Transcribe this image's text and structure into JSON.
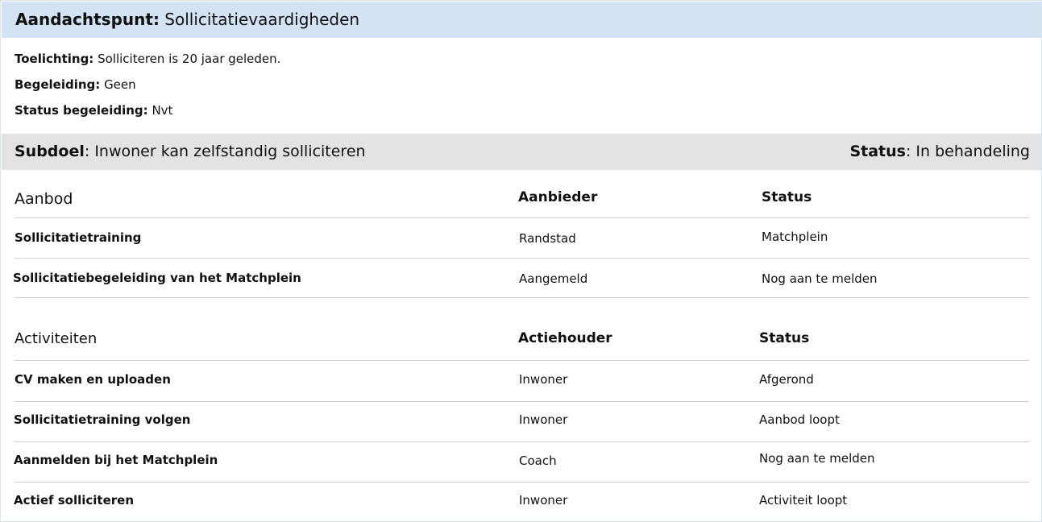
{
  "header": {
    "label": "Aandachtspunt:",
    "value": "Sollicitatievaardigheden"
  },
  "info": {
    "toelichting_label": "Toelichting:",
    "toelichting_value": "Solliciteren is 20 jaar geleden.",
    "begeleiding_label": "Begeleiding:",
    "begeleiding_value": "Geen",
    "status_begeleiding_label": "Status begeleiding:",
    "status_begeleiding_value": "Nvt"
  },
  "subdoel": {
    "label": "Subdoel",
    "value": ": Inwoner kan zelfstandig solliciteren",
    "status_label": "Status",
    "status_value": ": In behandeling"
  },
  "aanbod": {
    "headers": [
      "Aanbod",
      "Aanbieder",
      "Status"
    ],
    "rows": [
      [
        "Sollicitatietraining",
        "Randstad",
        "Matchplein"
      ],
      [
        "Sollicitatiebegeleiding van het Matchplein",
        "Aangemeld",
        "Nog aan te melden"
      ]
    ]
  },
  "activiteiten": {
    "headers": [
      "Activiteiten",
      "Actiehouder",
      "Status"
    ],
    "rows": [
      [
        "CV maken en uploaden",
        "Inwoner",
        "Afgerond"
      ],
      [
        "Sollicitatietraining volgen",
        "Inwoner",
        "Aanbod loopt"
      ],
      [
        "Aanmelden bij het Matchplein",
        "Coach",
        "Nog aan te melden"
      ],
      [
        "Actief solliciteren",
        "Inwoner",
        "Activiteit loopt"
      ]
    ]
  }
}
